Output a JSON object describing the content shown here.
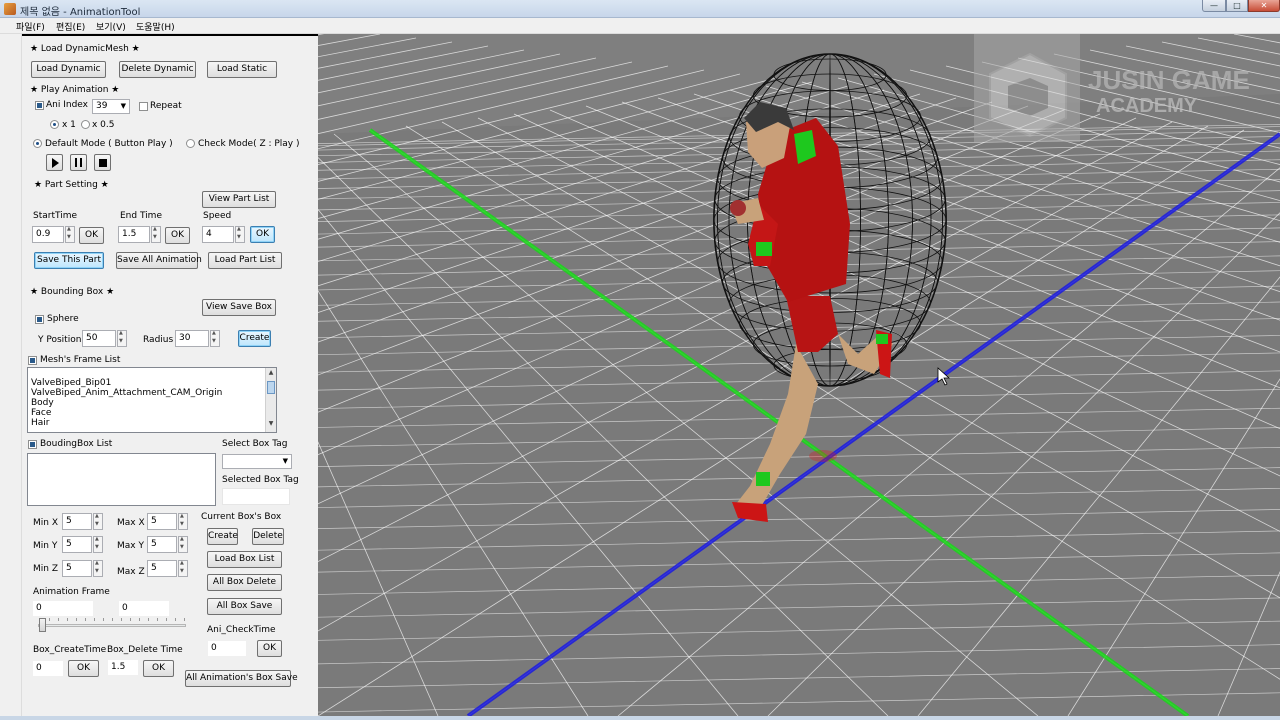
{
  "window": {
    "title": "제목 없음 - AnimationTool",
    "buttons": {
      "minimize": "—",
      "maximize": "□",
      "close": "✕"
    }
  },
  "menu": [
    "파일(F)",
    "편집(E)",
    "보기(V)",
    "도움말(H)"
  ],
  "load_mesh": {
    "header": "★ Load DynamicMesh ★",
    "load_dynamic": "Load Dynamic",
    "delete_dynamic": "Delete Dynamic",
    "load_static": "Load Static"
  },
  "play_animation": {
    "header": "★ Play Animation ★",
    "ani_index_label": "Ani Index",
    "ani_index_value": "39",
    "repeat_label": "Repeat",
    "speed_x1": "x 1",
    "speed_x05": "x 0.5",
    "default_mode": "Default Mode ( Button Play )",
    "check_mode": "Check Mode( Z : Play )"
  },
  "part_setting": {
    "header": "★ Part Setting ★",
    "view_part_list": "View Part List",
    "start_time_label": "StartTime",
    "end_time_label": "End Time",
    "speed_label": "Speed",
    "start_time": "0.9",
    "end_time": "1.5",
    "speed": "4",
    "ok": "OK",
    "save_this_part": "Save This Part",
    "save_all_animation": "Save All Animation",
    "load_part_list": "Load Part List"
  },
  "bounding_box": {
    "header": "★ Bounding Box ★",
    "view_save_box": "View Save Box",
    "sphere_label": "Sphere",
    "y_position_label": "Y Position",
    "y_position": "50",
    "radius_label": "Radius",
    "radius": "30",
    "create": "Create"
  },
  "frame_list": {
    "label": "Mesh's Frame List",
    "items": [
      "",
      "ValveBiped_Bip01",
      "ValveBiped_Anim_Attachment_CAM_Origin",
      "Body",
      "Face",
      "Hair"
    ]
  },
  "box_list": {
    "label": "BoudingBox List",
    "select_box_tag": "Select Box Tag",
    "selected_box_tag": "Selected Box Tag"
  },
  "box_params": {
    "min_x_label": "Min X",
    "min_x": "5",
    "max_x_label": "Max X",
    "max_x": "5",
    "min_y_label": "Min Y",
    "min_y": "5",
    "max_y_label": "Max Y",
    "max_y": "5",
    "min_z_label": "Min Z",
    "min_z": "5",
    "max_z_label": "Max Z",
    "max_z": "5",
    "current_box_label": "Current Box's Box",
    "create": "Create",
    "delete": "Delete",
    "load_box_list": "Load Box List",
    "all_box_delete": "All Box Delete",
    "all_box_save": "All Box Save"
  },
  "animation_frame": {
    "label": "Animation Frame",
    "value_a": "0",
    "value_b": "0",
    "slider_fraction": 0.0,
    "ani_check_time_label": "Ani_CheckTime",
    "ani_check_time": "0",
    "ok": "OK",
    "box_create_time_label": "Box_CreateTime",
    "box_delete_time_label": "Box_Delete Time",
    "box_create_time": "0",
    "box_delete_time": "1.5",
    "all_animations_box_save": "All Animation's Box Save"
  },
  "viewport": {
    "watermark": "JUSIN GAME ACADEMY",
    "axis_colors": {
      "x": "#1fd41f",
      "z": "#2020e6",
      "marker": "#d42020"
    },
    "background": "#7f7f7f"
  }
}
